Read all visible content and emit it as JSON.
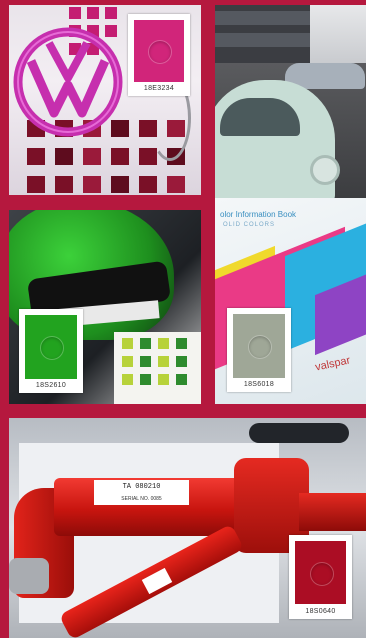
{
  "colors": {
    "frame": "#b5183e",
    "swatch_pink": "#d1257a",
    "swatch_green": "#22a31f",
    "swatch_sage": "#9fa797",
    "swatch_red": "#ab0d24"
  },
  "panels": {
    "pink": {
      "swatch_code": "18E3234"
    },
    "green": {
      "swatch_code": "18S2610"
    },
    "sage": {
      "swatch_code": "18S6018"
    },
    "red": {
      "swatch_code": "18S0640",
      "pipe_label_main": "TA 080210",
      "pipe_label_sub": "SERIAL NO. 0085"
    }
  },
  "book": {
    "title": "olor Information Book",
    "subtitle": "OLID COLORS",
    "brand": "valspar"
  }
}
